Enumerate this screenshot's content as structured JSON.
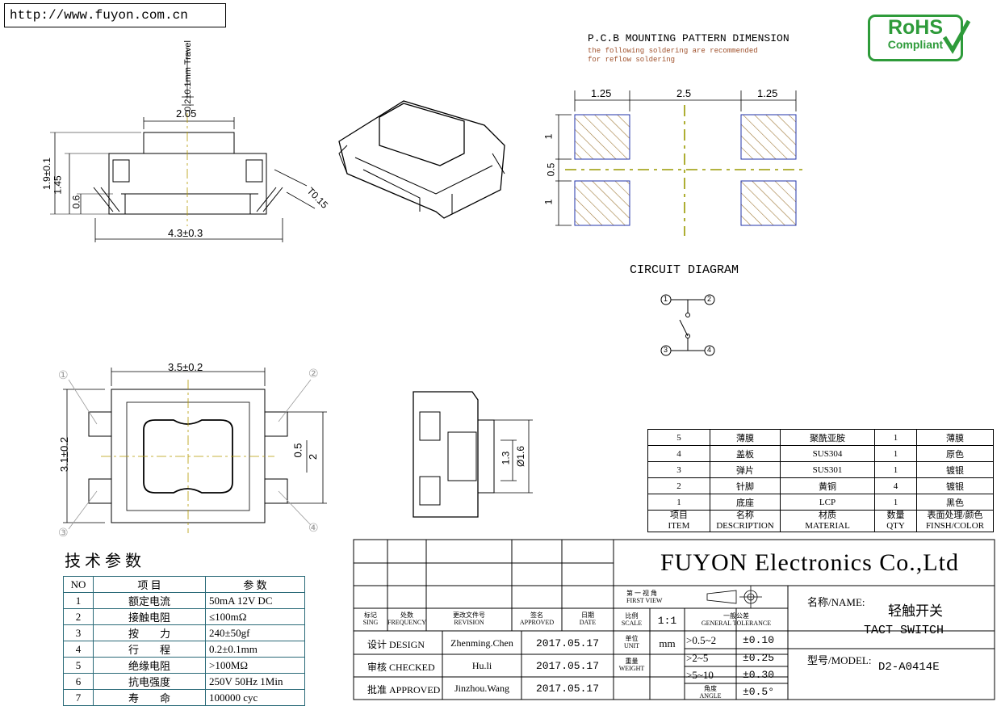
{
  "url": "http://www.fuyon.com.cn",
  "rohs": {
    "line1": "RoHS",
    "line2": "Compliant"
  },
  "pcb": {
    "title": "P.C.B MOUNTING PATTERN DIMENSION",
    "note1": "the following soldering are recommended",
    "note2": "for reflow soldering",
    "dims": {
      "pad_w_left": "1.25",
      "pitch": "2.5",
      "pad_w_right": "1.25",
      "pad_h_top": "1",
      "gap": "0.5",
      "pad_h_bottom": "1"
    }
  },
  "side_view": {
    "travel": "0.2±0.1mm Travel",
    "stem_w": "2.05",
    "h_total": "1.9±0.1",
    "h_body": "1.45",
    "h_lead": "0.6",
    "thickness": "T0.15",
    "width": "4.3±0.3"
  },
  "circuit": {
    "title": "CIRCUIT DIAGRAM",
    "pins": [
      "1",
      "2",
      "3",
      "4"
    ]
  },
  "top_view": {
    "width": "3.5±0.2",
    "height": "3.1±0.2",
    "dim_05": "0.5",
    "dim_2": "2",
    "pins": [
      "①",
      "②",
      "③",
      "④"
    ]
  },
  "end_view": {
    "dim_13": "1.3",
    "dim_16": "Ø1.6"
  },
  "spec": {
    "title": "技 术 参 数",
    "headers": [
      "NO",
      "项 目",
      "参 数"
    ],
    "rows": [
      [
        "1",
        "额定电流",
        "50mA 12V DC"
      ],
      [
        "2",
        "接触电阻",
        "≤100mΩ"
      ],
      [
        "3",
        "按　　力",
        "240±50gf"
      ],
      [
        "4",
        "行　　程",
        "0.2±0.1mm"
      ],
      [
        "5",
        "绝缘电阻",
        ">100MΩ"
      ],
      [
        "6",
        "抗电强度",
        "250V 50Hz 1Min"
      ],
      [
        "7",
        "寿　　命",
        "100000 cyc"
      ]
    ]
  },
  "bom": {
    "rows": [
      [
        "5",
        "薄膜",
        "聚酰亚胺",
        "1",
        "薄膜"
      ],
      [
        "4",
        "盖板",
        "SUS304",
        "1",
        "原色"
      ],
      [
        "3",
        "弹片",
        "SUS301",
        "1",
        "镀银"
      ],
      [
        "2",
        "针脚",
        "黄铜",
        "4",
        "镀银"
      ],
      [
        "1",
        "底座",
        "LCP",
        "1",
        "黑色"
      ]
    ],
    "headers_cn": [
      "项目",
      "名称",
      "材质",
      "数量",
      "表面处理/颜色"
    ],
    "headers_en": [
      "ITEM",
      "DESCRIPTION",
      "MATERIAL",
      "QTY",
      "FINSH/COLOR"
    ]
  },
  "title_block": {
    "company": "FUYON Electronics Co.,Ltd",
    "rev_headers": [
      [
        "标记",
        "SING"
      ],
      [
        "处数",
        "FREQUENCY"
      ],
      [
        "更改文件号",
        "REVISION"
      ],
      [
        "签名",
        "APPROVED"
      ],
      [
        "日期",
        "DATE"
      ]
    ],
    "rows": [
      {
        "label": "设计 DESIGN",
        "name": "Zhenming.Chen",
        "date": "2017.05.17"
      },
      {
        "label": "审核 CHECKED",
        "name": "Hu.li",
        "date": "2017.05.17"
      },
      {
        "label": "批准 APPROVED",
        "name": "Jinzhou.Wang",
        "date": "2017.05.17"
      }
    ],
    "first_view_cn": "第 一 视 角",
    "first_view_en": "FIRST VIEW",
    "scale_label_cn": "比例",
    "scale_label_en": "SCALE",
    "scale": "1:1",
    "tol_label_cn": "一般公差",
    "tol_label_en": "GENERAL TOLERANCE",
    "unit_cn": "单位",
    "unit_en": "UNIT",
    "unit": "mm",
    "weight_cn": "重量",
    "weight_en": "WEIGHT",
    "angle_cn": "角度",
    "angle_en": "ANGLE",
    "tolerances": [
      [
        ">0.5~2",
        "±0.10"
      ],
      [
        ">2~5",
        "±0.25"
      ],
      [
        ">5~10",
        "±0.30"
      ]
    ],
    "angle_tol": "±0.5°",
    "name_label": "名称/NAME:",
    "name_cn": "轻触开关",
    "name_en": "TACT  SWITCH",
    "model_label": "型号/MODEL:",
    "model": "D2-A0414E"
  }
}
